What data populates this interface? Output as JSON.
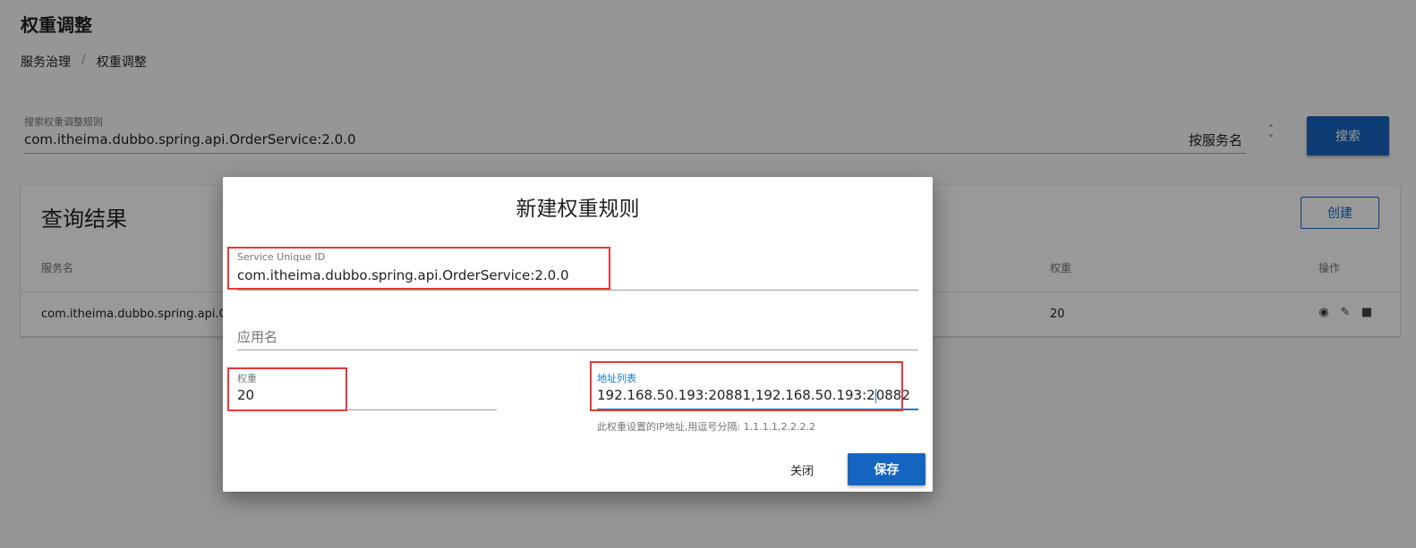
{
  "page": {
    "title": "权重调整",
    "breadcrumb": [
      "服务治理",
      "/",
      "权重调整"
    ]
  },
  "search": {
    "label": "搜索权重调整规则",
    "value": "com.itheima.dubbo.spring.api.OrderService:2.0.0",
    "mode": "按服务名",
    "button": "搜索"
  },
  "results": {
    "title": "查询结果",
    "create_button": "创建",
    "headers": {
      "service": "服务名",
      "weight": "权重",
      "action": "操作"
    },
    "rows": [
      {
        "service": "com.itheima.dubbo.spring.api.Orde",
        "weight": "20"
      }
    ],
    "row_action_icons": [
      "eye-icon",
      "pencil-icon",
      "trash-icon"
    ]
  },
  "dialog": {
    "title": "新建权重规则",
    "service_id": {
      "label": "Service Unique ID",
      "value": "com.itheima.dubbo.spring.api.OrderService:2.0.0"
    },
    "app_name": {
      "placeholder": "应用名"
    },
    "weight": {
      "label": "权重",
      "value": "20"
    },
    "address": {
      "label": "地址列表",
      "value_before_caret": "192.168.50.193:20881,192.168.50.193:2",
      "value_after_caret": "0882",
      "hint": "此权重设置的IP地址,用逗号分隔: 1.1.1.1,2.2.2.2"
    },
    "close_button": "关闭",
    "save_button": "保存"
  },
  "colors": {
    "primary": "#1565c0",
    "highlight": "#e53935",
    "focus": "#1976d2"
  }
}
